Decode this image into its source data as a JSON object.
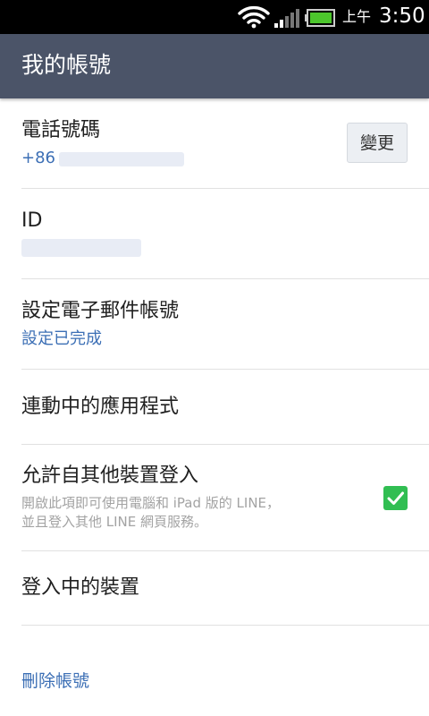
{
  "status_bar": {
    "ampm": "上午",
    "time": "3:50",
    "icons": [
      "wifi-icon",
      "signal-icon",
      "battery-icon"
    ],
    "battery_color": "#4cc62c"
  },
  "app_bar": {
    "title": "我的帳號",
    "background": "#4b5468"
  },
  "phone": {
    "title": "電話號碼",
    "number": "+86",
    "change_label": "變更"
  },
  "id_row": {
    "title": "ID"
  },
  "email": {
    "title": "設定電子郵件帳號",
    "status": "設定已完成"
  },
  "linked_apps": {
    "title": "連動中的應用程式"
  },
  "allow_login": {
    "title": "允許自其他裝置登入",
    "description_line1": "開啟此項即可使用電腦和 iPad 版的 LINE，",
    "description_line2": "並且登入其他 LINE 網頁服務。",
    "checked": true,
    "check_color": "#31be52"
  },
  "logged_in_devices": {
    "title": "登入中的裝置"
  },
  "delete_account": {
    "label": "刪除帳號"
  },
  "accent_color": "#3c6fb5"
}
